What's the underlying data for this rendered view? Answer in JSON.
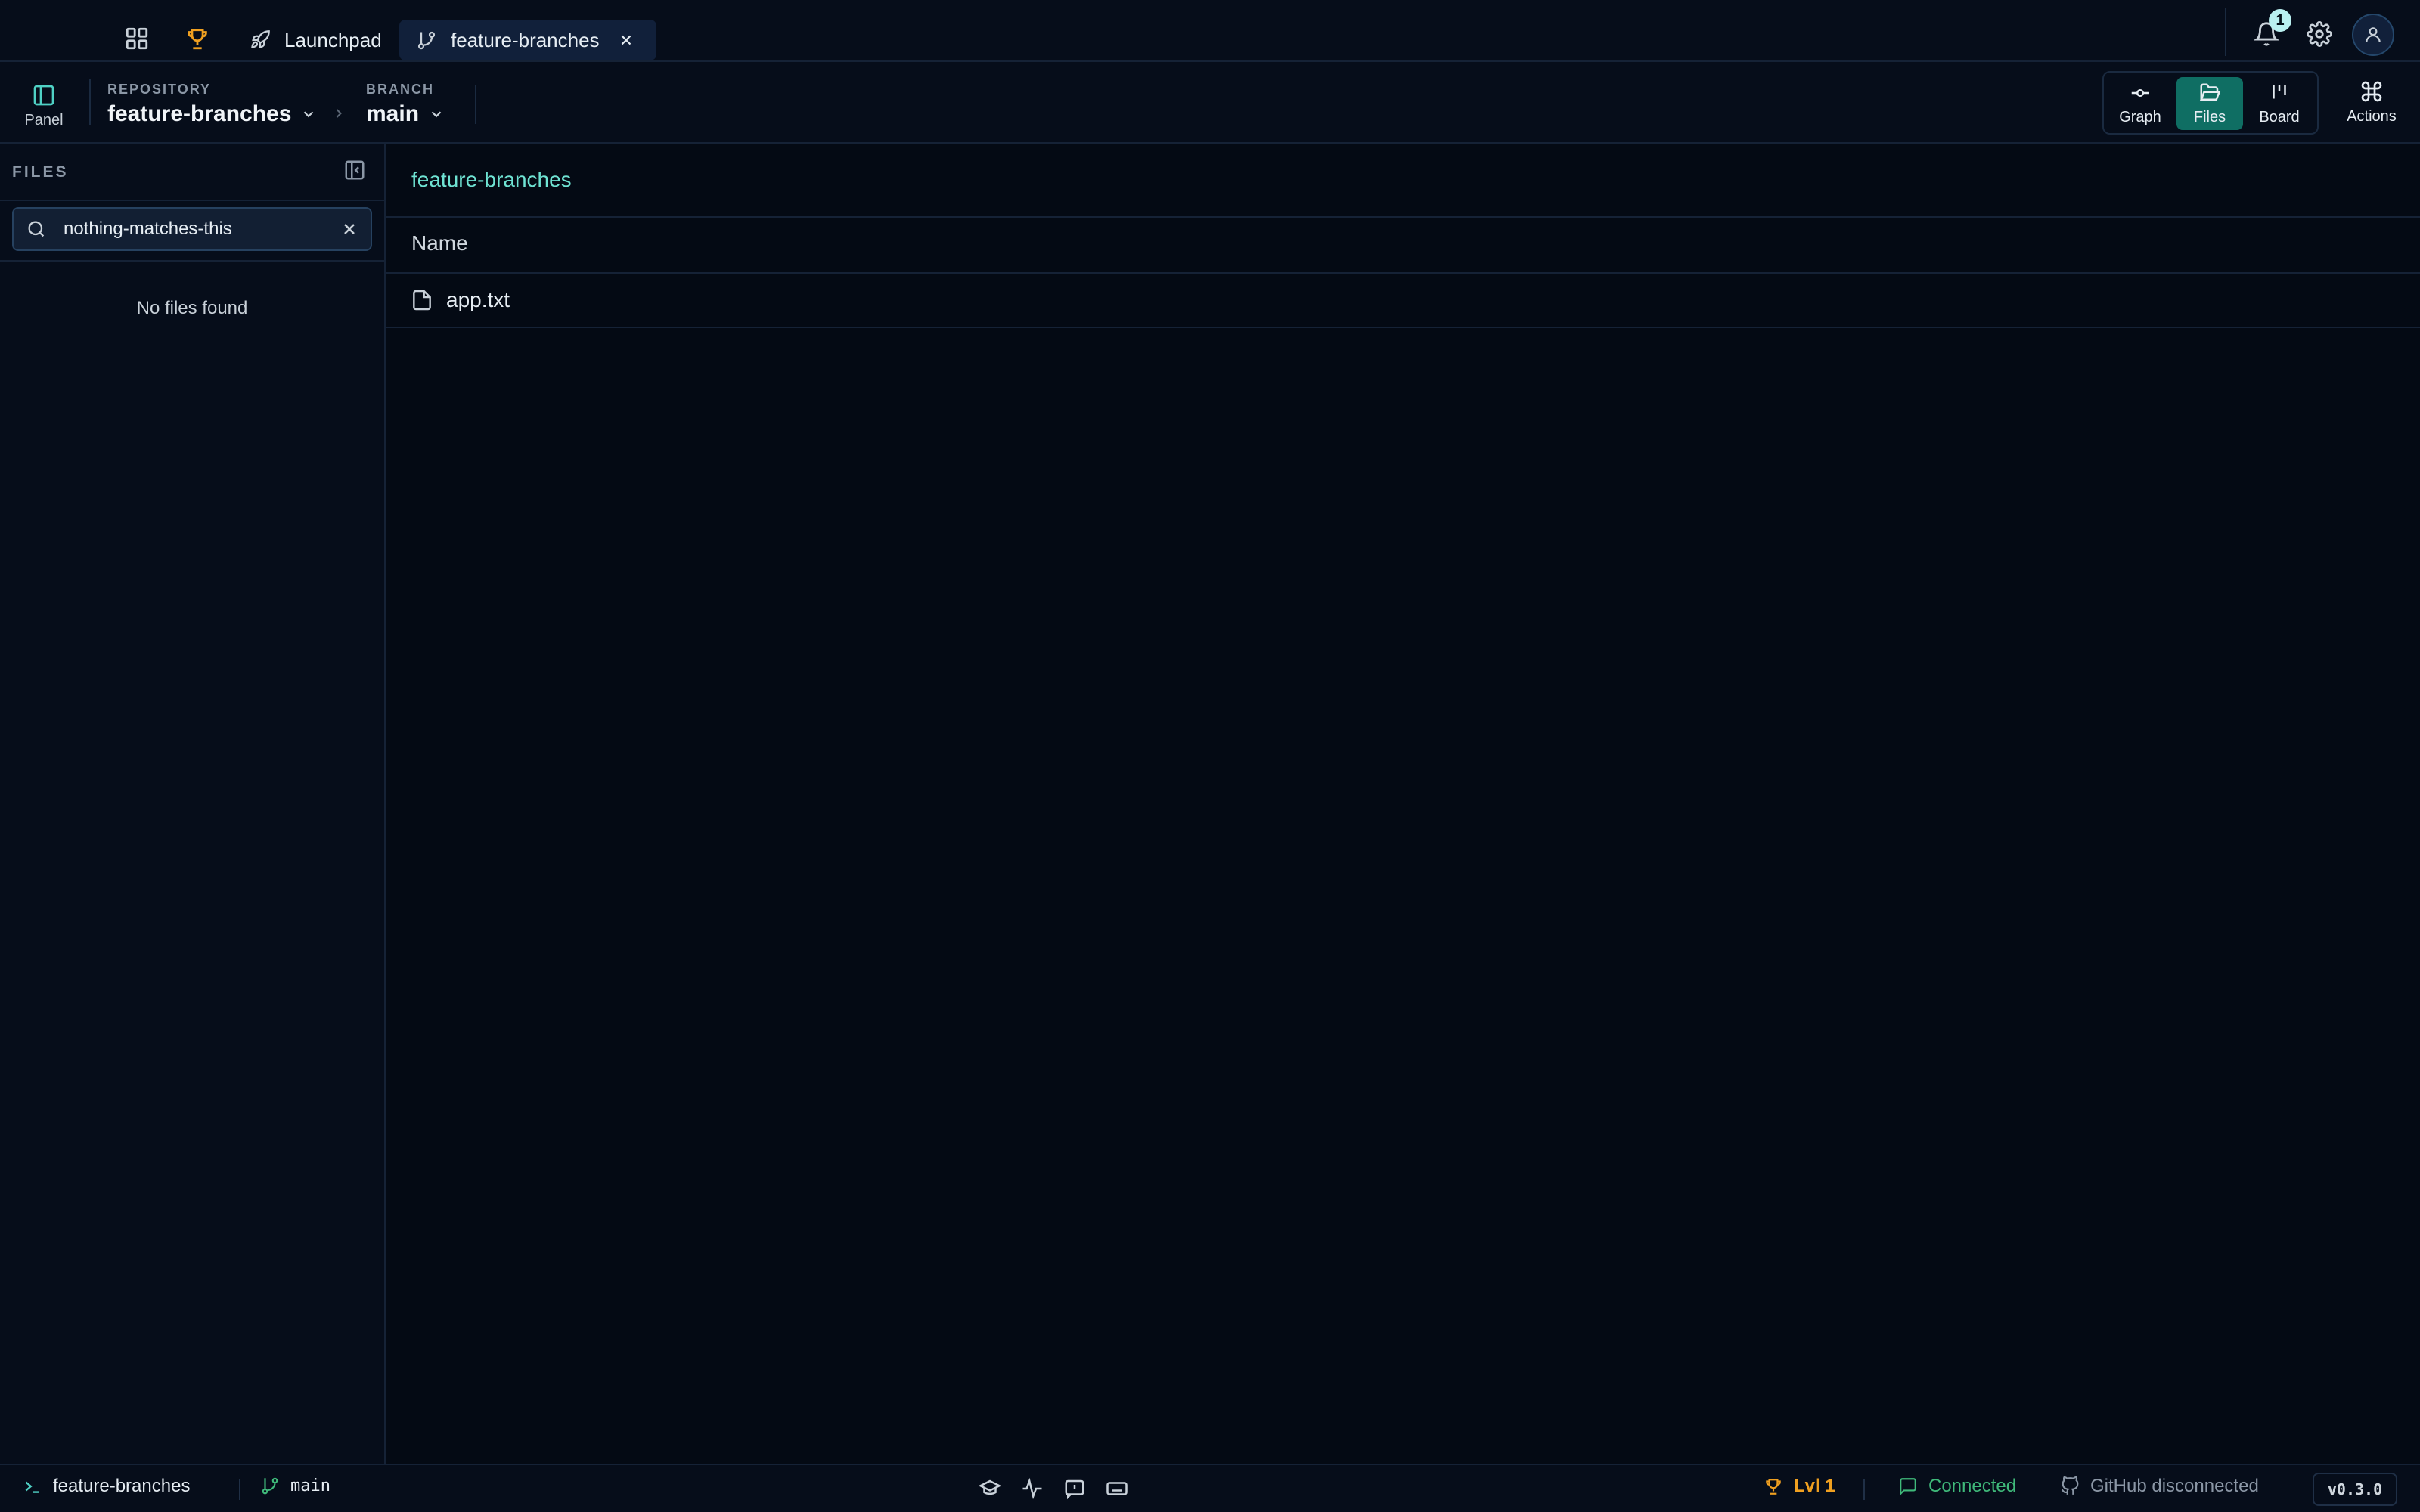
{
  "tabs": {
    "launchpad_label": "Launchpad",
    "active_label": "feature-branches"
  },
  "notifications": {
    "count": "1"
  },
  "toolbar": {
    "panel_label": "Panel",
    "repository_label": "REPOSITORY",
    "repository_value": "feature-branches",
    "branch_label": "BRANCH",
    "branch_value": "main",
    "views": {
      "graph": "Graph",
      "files": "Files",
      "board": "Board"
    },
    "active_view": "Files",
    "actions_label": "Actions"
  },
  "sidebar": {
    "title": "FILES",
    "search_value": "nothing-matches-this",
    "empty_message": "No files found"
  },
  "main": {
    "title": "feature-branches",
    "column_header": "Name",
    "files": [
      {
        "name": "app.txt"
      }
    ]
  },
  "status_bar": {
    "repo": "feature-branches",
    "branch": "main",
    "level": "Lvl 1",
    "connection": "Connected",
    "github": "GitHub disconnected",
    "version": "v0.3.0"
  },
  "colors": {
    "accent": "#4fd1c5",
    "active_view_bg": "#0f6e63",
    "trophy": "#f0a020",
    "connected": "#3fb97a"
  }
}
